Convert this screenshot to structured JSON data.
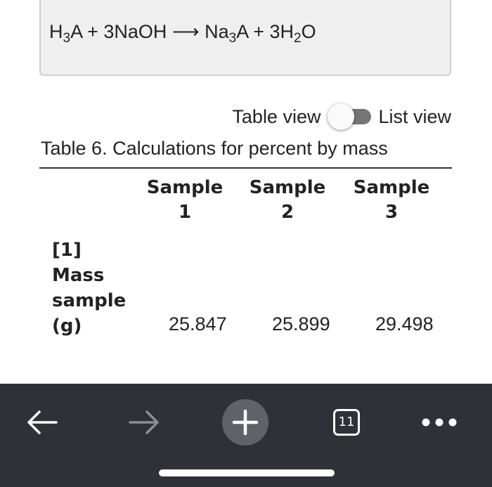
{
  "equation": {
    "h": "H",
    "sub3a": "3",
    "a_plus": "A + 3NaOH ",
    "arrow": "⟶",
    "na": " Na",
    "sub3b": "3",
    "a_plus2": "A + 3H",
    "sub2": "2",
    "o": "O"
  },
  "view_toggle": {
    "left_label": "Table view",
    "right_label": "List view",
    "state": "table view"
  },
  "table": {
    "caption": "Table 6. Calculations for percent by mass",
    "columns": [
      {
        "line1": "Sample",
        "line2": "1"
      },
      {
        "line1": "Sample",
        "line2": "2"
      },
      {
        "line1": "Sample",
        "line2": "3"
      }
    ],
    "rows": [
      {
        "label_lines": [
          "[1]",
          "Mass",
          "sample",
          "(g)"
        ],
        "values": [
          "25.847",
          "25.899",
          "29.498"
        ]
      }
    ]
  },
  "browser_bar": {
    "tab_count": "11",
    "icons": {
      "back": "back-arrow-icon",
      "forward": "forward-arrow-icon",
      "new_tab": "plus-icon",
      "tabs": "tab-switcher-icon",
      "more": "more-dots-icon"
    },
    "colors": {
      "background": "#2e3135",
      "forward_disabled": "#8a8d91",
      "new_tab_circle": "#5f6368"
    }
  }
}
